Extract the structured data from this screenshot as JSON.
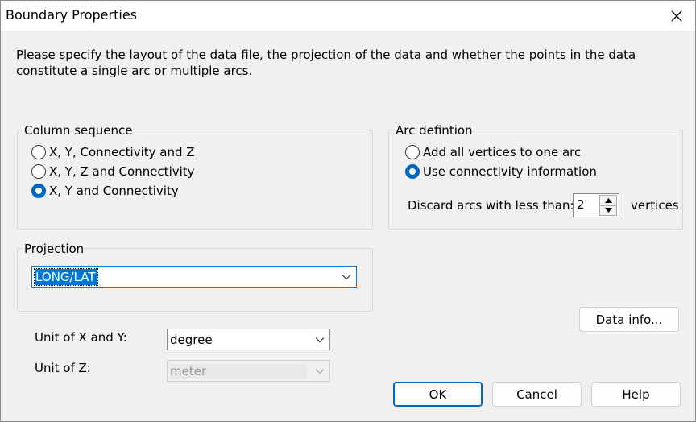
{
  "window": {
    "title": "Boundary Properties"
  },
  "description": "Please specify the layout of the data file, the projection of the data and whether the points in the data constitute a single arc or multiple arcs.",
  "column_sequence": {
    "label": "Column sequence",
    "options": [
      {
        "label": "X, Y, Connectivity and Z",
        "checked": false
      },
      {
        "label": "X, Y, Z and Connectivity",
        "checked": false
      },
      {
        "label": "X, Y and Connectivity",
        "checked": true
      }
    ]
  },
  "arc_definition": {
    "label": "Arc defintion",
    "options": [
      {
        "label": "Add all vertices to one arc",
        "checked": false
      },
      {
        "label": "Use connectivity information",
        "checked": true
      }
    ],
    "discard_label": "Discard arcs with less than:",
    "discard_value": "2",
    "vertices_label": "vertices"
  },
  "projection": {
    "label": "Projection",
    "value": "LONG/LAT"
  },
  "units": {
    "xy_label": "Unit of X and Y:",
    "xy_value": "degree",
    "z_label": "Unit of Z:",
    "z_value": "meter"
  },
  "buttons": {
    "data_info": "Data info...",
    "ok": "OK",
    "cancel": "Cancel",
    "help": "Help"
  },
  "colors": {
    "accent": "#0067c0",
    "selection": "#0078d7"
  },
  "icons": [
    "close-icon",
    "chevron-down-icon",
    "spin-up-icon",
    "spin-down-icon"
  ]
}
